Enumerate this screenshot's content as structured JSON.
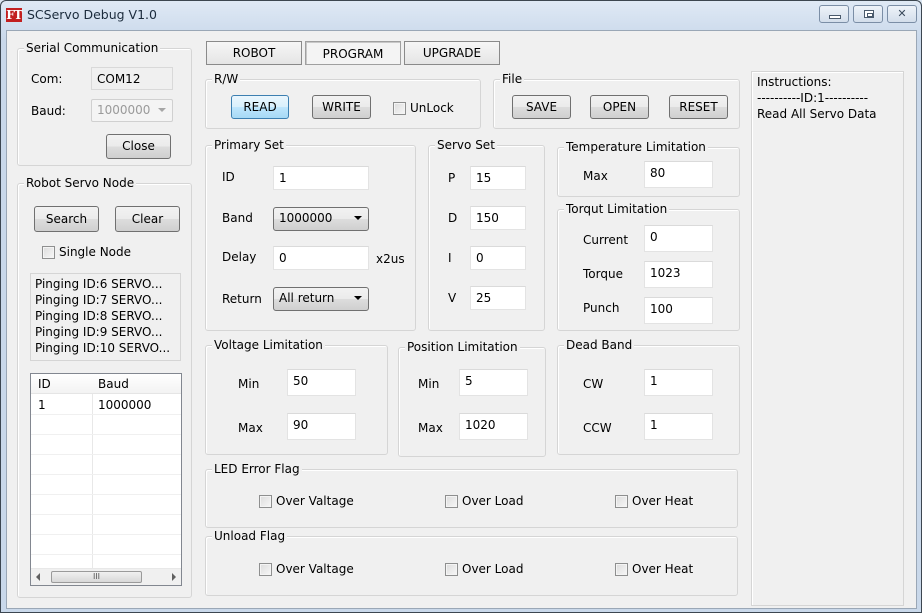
{
  "window": {
    "title": "SCServo Debug V1.0",
    "logo": "FT",
    "controls": [
      "minimize",
      "maximize",
      "close"
    ]
  },
  "serial": {
    "title": "Serial Communication",
    "com_label": "Com:",
    "com_value": "COM12",
    "baud_label": "Baud:",
    "baud_value": "1000000",
    "close_button": "Close"
  },
  "node": {
    "title": "Robot Servo Node",
    "search_button": "Search",
    "clear_button": "Clear",
    "single_node_label": "Single Node",
    "single_node_checked": false,
    "log": [
      "Pinging ID:6 SERVO...",
      "Pinging ID:7 SERVO...",
      "Pinging ID:8 SERVO...",
      "Pinging ID:9 SERVO...",
      "Pinging ID:10 SERVO..."
    ],
    "table": {
      "columns": [
        "ID",
        "Baud"
      ],
      "rows": [
        [
          "1",
          "1000000"
        ]
      ],
      "scroll_thumb": "III"
    }
  },
  "tabs": [
    {
      "label": "ROBOT",
      "selected": false
    },
    {
      "label": "PROGRAM",
      "selected": true
    },
    {
      "label": "UPGRADE",
      "selected": false
    }
  ],
  "rw": {
    "title": "R/W",
    "read_button": "READ",
    "write_button": "WRITE",
    "unlock_label": "UnLock",
    "unlock_checked": false
  },
  "file": {
    "title": "File",
    "save_button": "SAVE",
    "open_button": "OPEN",
    "reset_button": "RESET"
  },
  "primary": {
    "title": "Primary Set",
    "id_label": "ID",
    "id_value": "1",
    "band_label": "Band",
    "band_value": "1000000",
    "delay_label": "Delay",
    "delay_value": "0",
    "delay_unit": "x2us",
    "return_label": "Return",
    "return_value": "All return"
  },
  "servo_set": {
    "title": "Servo Set",
    "p_label": "P",
    "p_value": "15",
    "d_label": "D",
    "d_value": "150",
    "i_label": "I",
    "i_value": "0",
    "v_label": "V",
    "v_value": "25"
  },
  "temperature": {
    "title": "Temperature Limitation",
    "max_label": "Max",
    "max_value": "80"
  },
  "torque": {
    "title": "Torqut Limitation",
    "current_label": "Current",
    "current_value": "0",
    "torque_label": "Torque",
    "torque_value": "1023",
    "punch_label": "Punch",
    "punch_value": "100"
  },
  "voltage": {
    "title": "Voltage Limitation",
    "min_label": "Min",
    "min_value": "50",
    "max_label": "Max",
    "max_value": "90"
  },
  "position": {
    "title": "Position Limitation",
    "min_label": "Min",
    "min_value": "5",
    "max_label": "Max",
    "max_value": "1020"
  },
  "dead_band": {
    "title": "Dead Band",
    "cw_label": "CW",
    "cw_value": "1",
    "ccw_label": "CCW",
    "ccw_value": "1"
  },
  "led_error": {
    "title": "LED Error Flag",
    "over_voltage": "Over Valtage",
    "over_load": "Over Load",
    "over_heat": "Over Heat"
  },
  "unload": {
    "title": "Unload Flag",
    "over_voltage": "Over Valtage",
    "over_load": "Over Load",
    "over_heat": "Over Heat"
  },
  "instructions": {
    "lines": [
      "Instructions:",
      "----------ID:1----------",
      "Read All Servo Data"
    ]
  }
}
